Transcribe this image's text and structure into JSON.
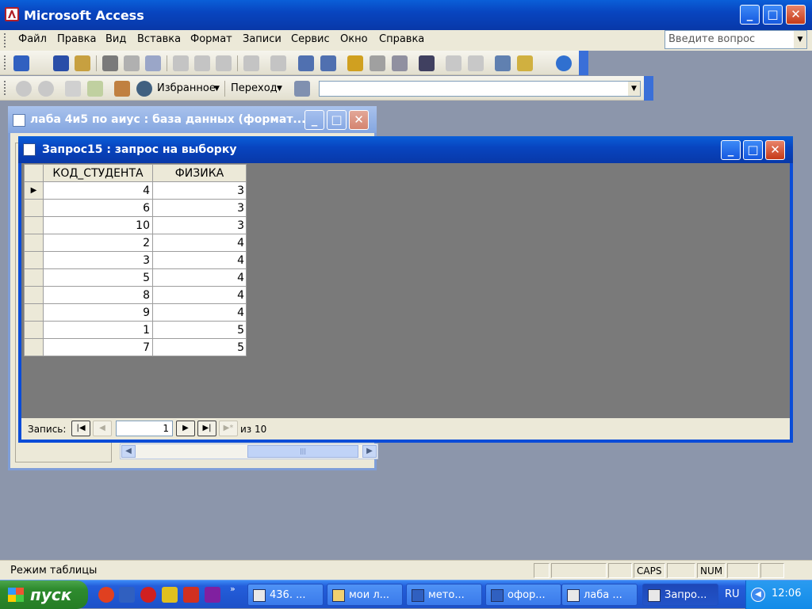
{
  "app": {
    "title": "Microsoft Access",
    "min": "_",
    "max": "□",
    "close": "✕"
  },
  "menu": {
    "items": [
      "Файл",
      "Правка",
      "Вид",
      "Вставка",
      "Формат",
      "Записи",
      "Сервис",
      "Окно",
      "Справка"
    ],
    "ask_placeholder": "Введите вопрос"
  },
  "web_toolbar": {
    "favorites": "Избранное",
    "go": "Переход"
  },
  "db_window": {
    "title": "лаба 4и5 по аиус : база данных (формат..."
  },
  "query_window": {
    "title": "Запрос15 : запрос на выборку"
  },
  "grid": {
    "columns": [
      "КОД_СТУДЕНТА",
      "ФИЗИКА"
    ],
    "rows": [
      [
        "4",
        "3"
      ],
      [
        "6",
        "3"
      ],
      [
        "10",
        "3"
      ],
      [
        "2",
        "4"
      ],
      [
        "3",
        "4"
      ],
      [
        "5",
        "4"
      ],
      [
        "8",
        "4"
      ],
      [
        "9",
        "4"
      ],
      [
        "1",
        "5"
      ],
      [
        "7",
        "5"
      ]
    ]
  },
  "nav": {
    "label": "Запись:",
    "current": "1",
    "of_label": "из",
    "total": "10"
  },
  "status": {
    "mode": "Режим таблицы",
    "caps": "CAPS",
    "num": "NUM"
  },
  "taskbar": {
    "start": "пуск",
    "tasks": [
      "436. ...",
      "мои л...",
      "мето...",
      "офор...",
      "лаба ...",
      "Запро..."
    ],
    "lang": "RU",
    "clock": "12:06"
  }
}
